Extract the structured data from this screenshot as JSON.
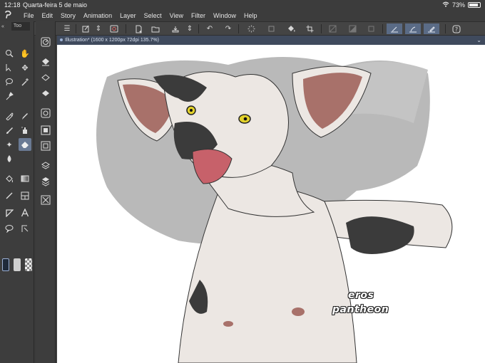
{
  "status_bar": {
    "time": "12:18",
    "date": "Quarta-feira 5 de maio",
    "battery": "73%",
    "battery_level": 0.73
  },
  "menu": {
    "app_icon": "clip-studio-logo-icon",
    "items": [
      "File",
      "Edit",
      "Story",
      "Animation",
      "Layer",
      "Select",
      "View",
      "Filter",
      "Window",
      "Help"
    ]
  },
  "tool_panel": {
    "tab_label": "Too",
    "selected_tool": "eraser-icon"
  },
  "document": {
    "tab_title": "Illustration* (1600 x 1200px 72dpi 135.7%)"
  },
  "artwork": {
    "watermark_line1": "eros",
    "watermark_line2": "pantheon",
    "colors": {
      "background_wash": "#b9b9b9",
      "fur": "#ece7e3",
      "ear_inner": "#a8716a",
      "spots": "#3b3b3b",
      "mouth": "#c7616a",
      "eyes": "#e3d22b"
    }
  },
  "colors": {
    "chrome_bg": "#3c3c3c",
    "accent_active": "#5a6b86",
    "doc_tab_bg": "#3f4a5d",
    "main_color": "#1f2a3a",
    "sub_color": "#cfcfcf"
  }
}
